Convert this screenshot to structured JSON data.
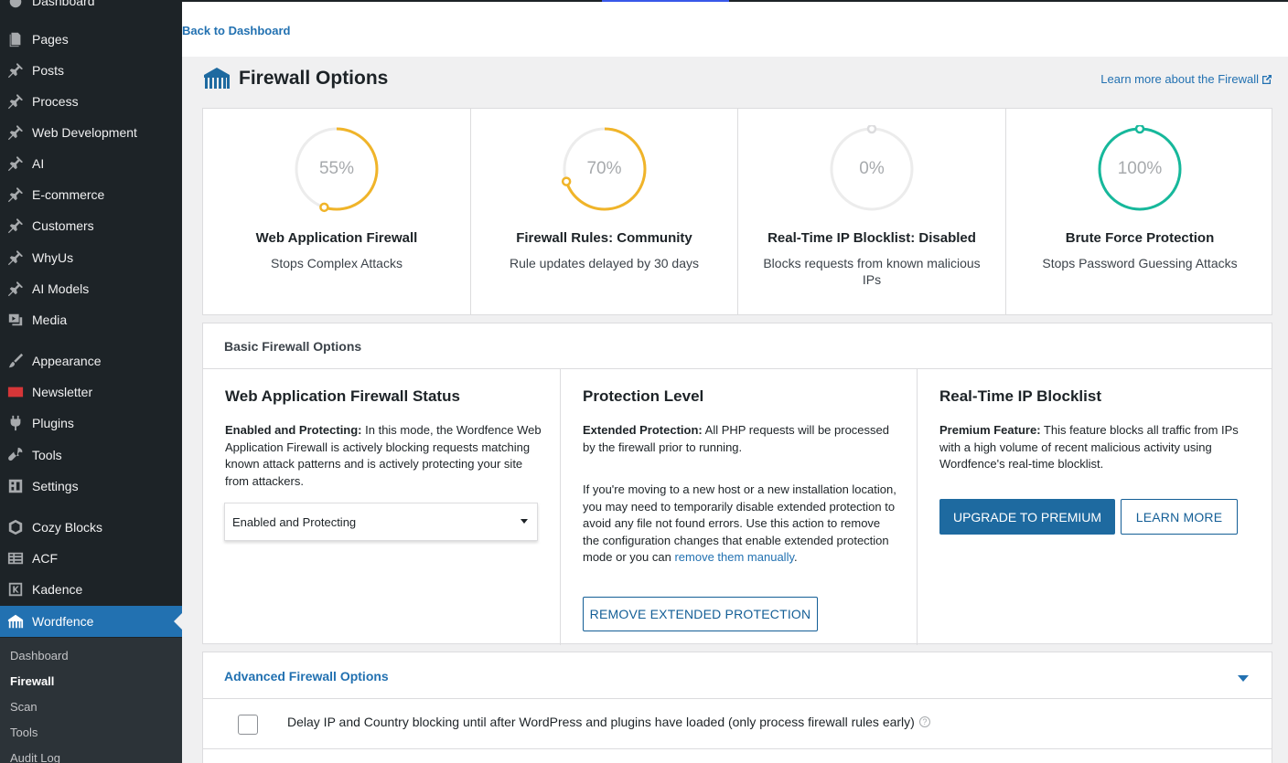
{
  "sidebar": {
    "top_item": "Dashboard",
    "items": [
      {
        "label": "Pages",
        "icon": "pages-icon"
      },
      {
        "label": "Posts",
        "icon": "pin-icon"
      },
      {
        "label": "Process",
        "icon": "pin-icon"
      },
      {
        "label": "Web Development",
        "icon": "pin-icon"
      },
      {
        "label": "AI",
        "icon": "pin-icon"
      },
      {
        "label": "E-commerce",
        "icon": "pin-icon"
      },
      {
        "label": "Customers",
        "icon": "pin-icon"
      },
      {
        "label": "WhyUs",
        "icon": "pin-icon"
      },
      {
        "label": "AI Models",
        "icon": "pin-icon"
      },
      {
        "label": "Media",
        "icon": "media-icon"
      },
      {
        "label": "Appearance",
        "icon": "brush-icon"
      },
      {
        "label": "Newsletter",
        "icon": "envelope-icon"
      },
      {
        "label": "Plugins",
        "icon": "plug-icon"
      },
      {
        "label": "Tools",
        "icon": "wrench-icon"
      },
      {
        "label": "Settings",
        "icon": "settings-icon"
      },
      {
        "label": "Cozy Blocks",
        "icon": "cozy-blocks-icon"
      },
      {
        "label": "ACF",
        "icon": "acf-icon"
      },
      {
        "label": "Kadence",
        "icon": "kadence-icon"
      },
      {
        "label": "Wordfence",
        "icon": "wordfence-icon"
      }
    ],
    "submenu": [
      "Dashboard",
      "Firewall",
      "Scan",
      "Tools",
      "Audit Log"
    ]
  },
  "back_link": "Back to Dashboard",
  "header": {
    "title": "Firewall Options",
    "learn_more": "Learn more about the Firewall"
  },
  "stats": [
    {
      "percent": "55%",
      "value": 0.55,
      "title": "Web Application Firewall",
      "desc": "Stops Complex Attacks",
      "color": "#f0b429"
    },
    {
      "percent": "70%",
      "value": 0.7,
      "title": "Firewall Rules: Community",
      "desc": "Rule updates delayed by 30 days",
      "color": "#f0b429"
    },
    {
      "percent": "0%",
      "value": 0.0,
      "title": "Real-Time IP Blocklist: Disabled",
      "desc": "Blocks requests from known malicious IPs",
      "color": "#dcdcde"
    },
    {
      "percent": "100%",
      "value": 1.0,
      "title": "Brute Force Protection",
      "desc": "Stops Password Guessing Attacks",
      "color": "#16b89b"
    }
  ],
  "basic": {
    "title": "Basic Firewall Options",
    "waf": {
      "heading": "Web Application Firewall Status",
      "lead": "Enabled and Protecting:",
      "text": " In this mode, the Wordfence Web Application Firewall is actively blocking requests matching known attack patterns and is actively protecting your site from attackers.",
      "select_value": "Enabled and Protecting"
    },
    "protection": {
      "heading": "Protection Level",
      "lead": "Extended Protection:",
      "text": " All PHP requests will be processed by the firewall prior to running.",
      "para2": "If you're moving to a new host or a new installation location, you may need to temporarily disable extended protection to avoid any file not found errors. Use this action to remove the configuration changes that enable extended protection mode or you can ",
      "link": "remove them manually",
      "para2_end": ".",
      "button": "REMOVE EXTENDED PROTECTION"
    },
    "blocklist": {
      "heading": "Real-Time IP Blocklist",
      "lead": "Premium Feature:",
      "text": " This feature blocks all traffic from IPs with a high volume of recent malicious activity using Wordfence's real-time blocklist.",
      "upgrade": "UPGRADE TO PREMIUM",
      "learn": "LEARN MORE"
    }
  },
  "advanced": {
    "title": "Advanced Firewall Options",
    "option": "Delay IP and Country blocking until after WordPress and plugins have loaded (only process firewall rules early)",
    "help": "?"
  }
}
